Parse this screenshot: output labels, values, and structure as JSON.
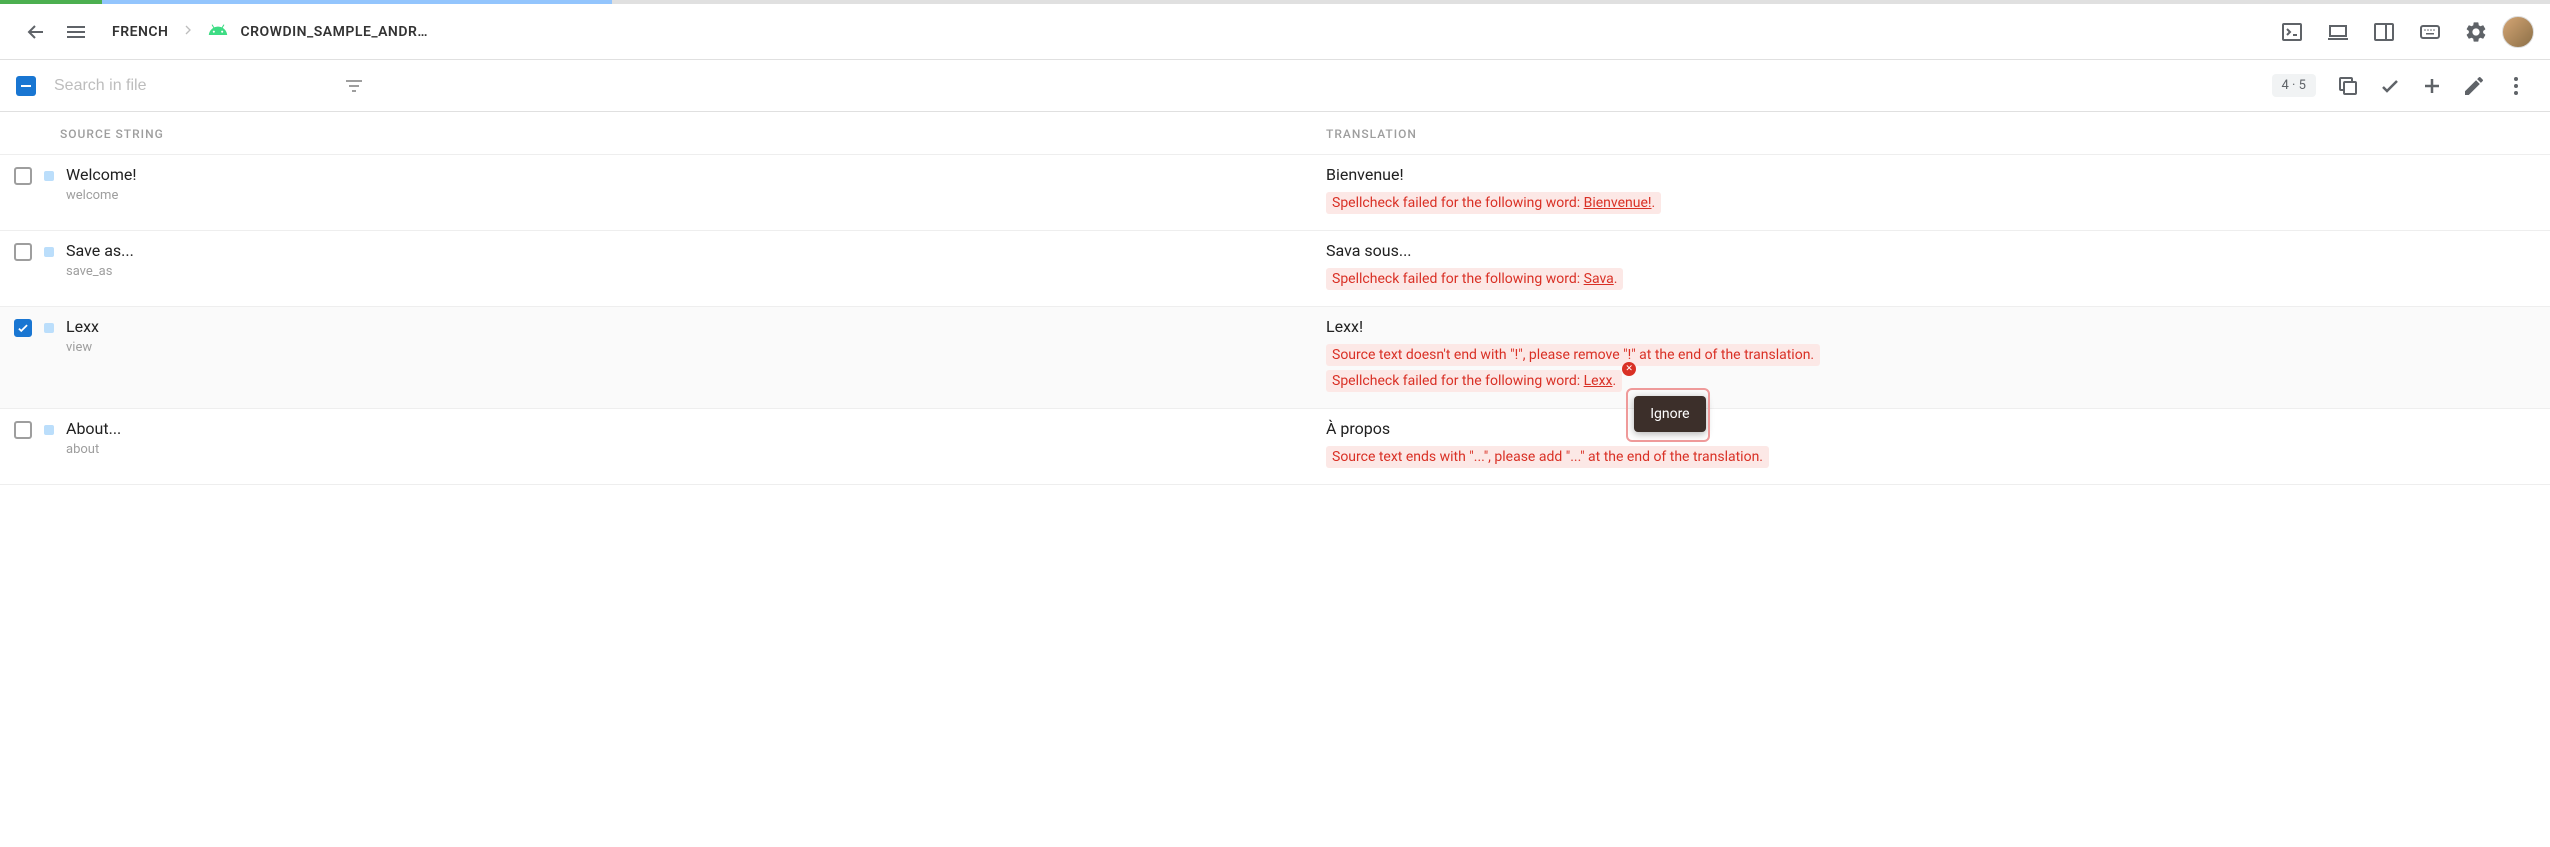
{
  "progress": {
    "green_pct": 4,
    "blue_pct": 20
  },
  "header": {
    "language": "FRENCH",
    "project": "CROWDIN_SAMPLE_ANDR…"
  },
  "toolbar": {
    "search_placeholder": "Search in file",
    "counter": "4 · 5"
  },
  "columns": {
    "source": "SOURCE STRING",
    "translation": "TRANSLATION"
  },
  "rows": [
    {
      "checked": false,
      "source": "Welcome!",
      "key": "welcome",
      "translation": "Bienvenue!",
      "warnings": [
        {
          "prefix": "Spellcheck failed for the following word: ",
          "word": "Bienvenue!",
          "suffix": "."
        }
      ]
    },
    {
      "checked": false,
      "source": "Save as...",
      "key": "save_as",
      "translation": "Sava sous...",
      "warnings": [
        {
          "prefix": "Spellcheck failed for the following word: ",
          "word": "Sava",
          "suffix": "."
        }
      ]
    },
    {
      "checked": true,
      "source": "Lexx",
      "key": "view",
      "translation": "Lexx!",
      "warnings": [
        {
          "prefix": "Source text doesn't end with \"!\", please remove \"!\" at the end of the translation.",
          "word": "",
          "suffix": ""
        },
        {
          "prefix": "Spellcheck failed for the following word: ",
          "word": "Lexx",
          "suffix": ".",
          "dismiss": true,
          "tooltip": "Ignore"
        }
      ]
    },
    {
      "checked": false,
      "source": "About...",
      "key": "about",
      "translation": "À propos",
      "warnings": [
        {
          "prefix": "Source text ends with \"...\", please add \"...\" at the end of the translation.",
          "word": "",
          "suffix": ""
        }
      ]
    }
  ]
}
